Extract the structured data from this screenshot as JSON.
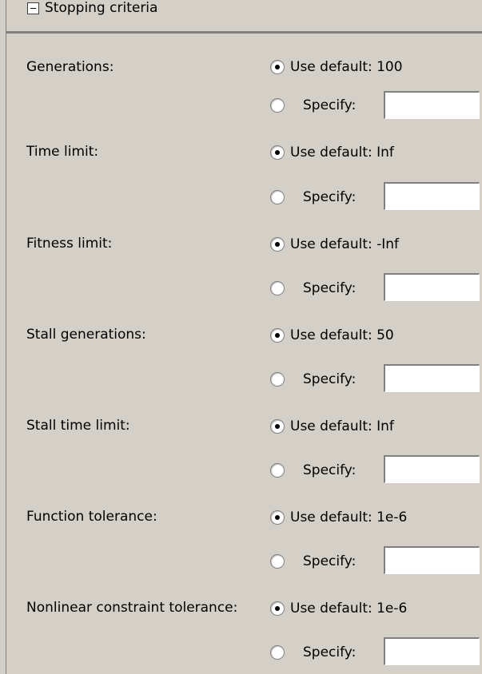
{
  "section": {
    "title": "Stopping criteria",
    "icon": "collapse-minus-icon"
  },
  "rows": [
    {
      "key": "generations",
      "label": "Generations:",
      "default_label": "Use default: 100",
      "specify_label": "Specify:",
      "specify_value": "",
      "selected": "default"
    },
    {
      "key": "time-limit",
      "label": "Time limit:",
      "default_label": "Use default: Inf",
      "specify_label": "Specify:",
      "specify_value": "",
      "selected": "default"
    },
    {
      "key": "fitness-limit",
      "label": "Fitness limit:",
      "default_label": "Use default: -Inf",
      "specify_label": "Specify:",
      "specify_value": "",
      "selected": "default"
    },
    {
      "key": "stall-generations",
      "label": "Stall generations:",
      "default_label": "Use default: 50",
      "specify_label": "Specify:",
      "specify_value": "",
      "selected": "default"
    },
    {
      "key": "stall-time-limit",
      "label": "Stall time limit:",
      "default_label": "Use default: Inf",
      "specify_label": "Specify:",
      "specify_value": "",
      "selected": "default"
    },
    {
      "key": "function-tolerance",
      "label": "Function tolerance:",
      "default_label": "Use default: 1e-6",
      "specify_label": "Specify:",
      "specify_value": "",
      "selected": "default"
    },
    {
      "key": "nonlinear-constraint-tolerance",
      "label": "Nonlinear constraint tolerance:",
      "default_label": "Use default: 1e-6",
      "specify_label": "Specify:",
      "specify_value": "",
      "selected": "default"
    }
  ],
  "colors": {
    "panel_background": "#d4d0c8",
    "border": "#808080",
    "field_background": "#ffffff"
  }
}
